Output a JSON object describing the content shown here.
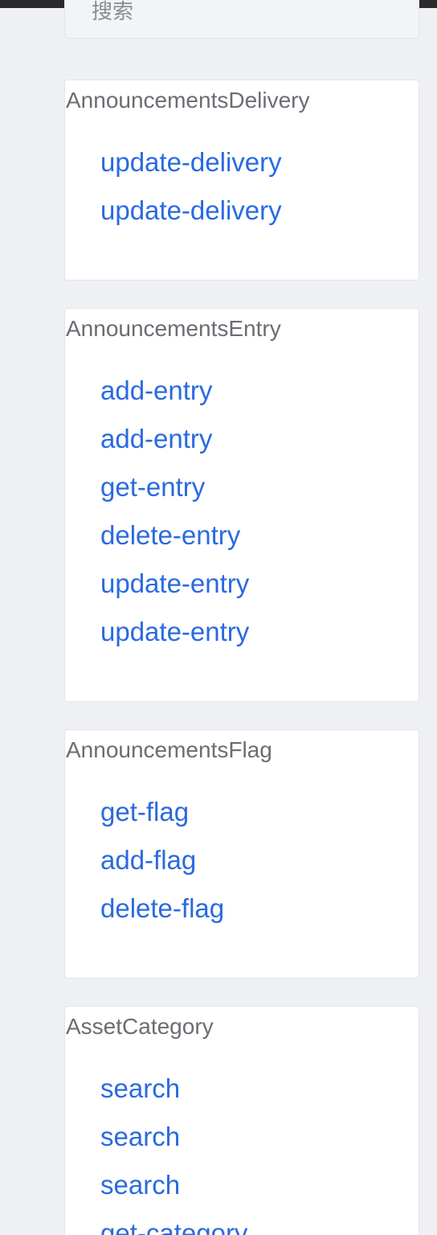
{
  "search": {
    "label": "搜索"
  },
  "groups": [
    {
      "title": "AnnouncementsDelivery",
      "links": [
        "update-delivery",
        "update-delivery"
      ]
    },
    {
      "title": "AnnouncementsEntry",
      "links": [
        "add-entry",
        "add-entry",
        "get-entry",
        "delete-entry",
        "update-entry",
        "update-entry"
      ]
    },
    {
      "title": "AnnouncementsFlag",
      "links": [
        "get-flag",
        "add-flag",
        "delete-flag"
      ]
    },
    {
      "title": "AssetCategory",
      "links": [
        "search",
        "search",
        "search",
        "get-category"
      ]
    }
  ],
  "colors": {
    "background": "#eef0f3",
    "card": "#ffffff",
    "link": "#2a6ae0",
    "title": "#6b6d73"
  }
}
